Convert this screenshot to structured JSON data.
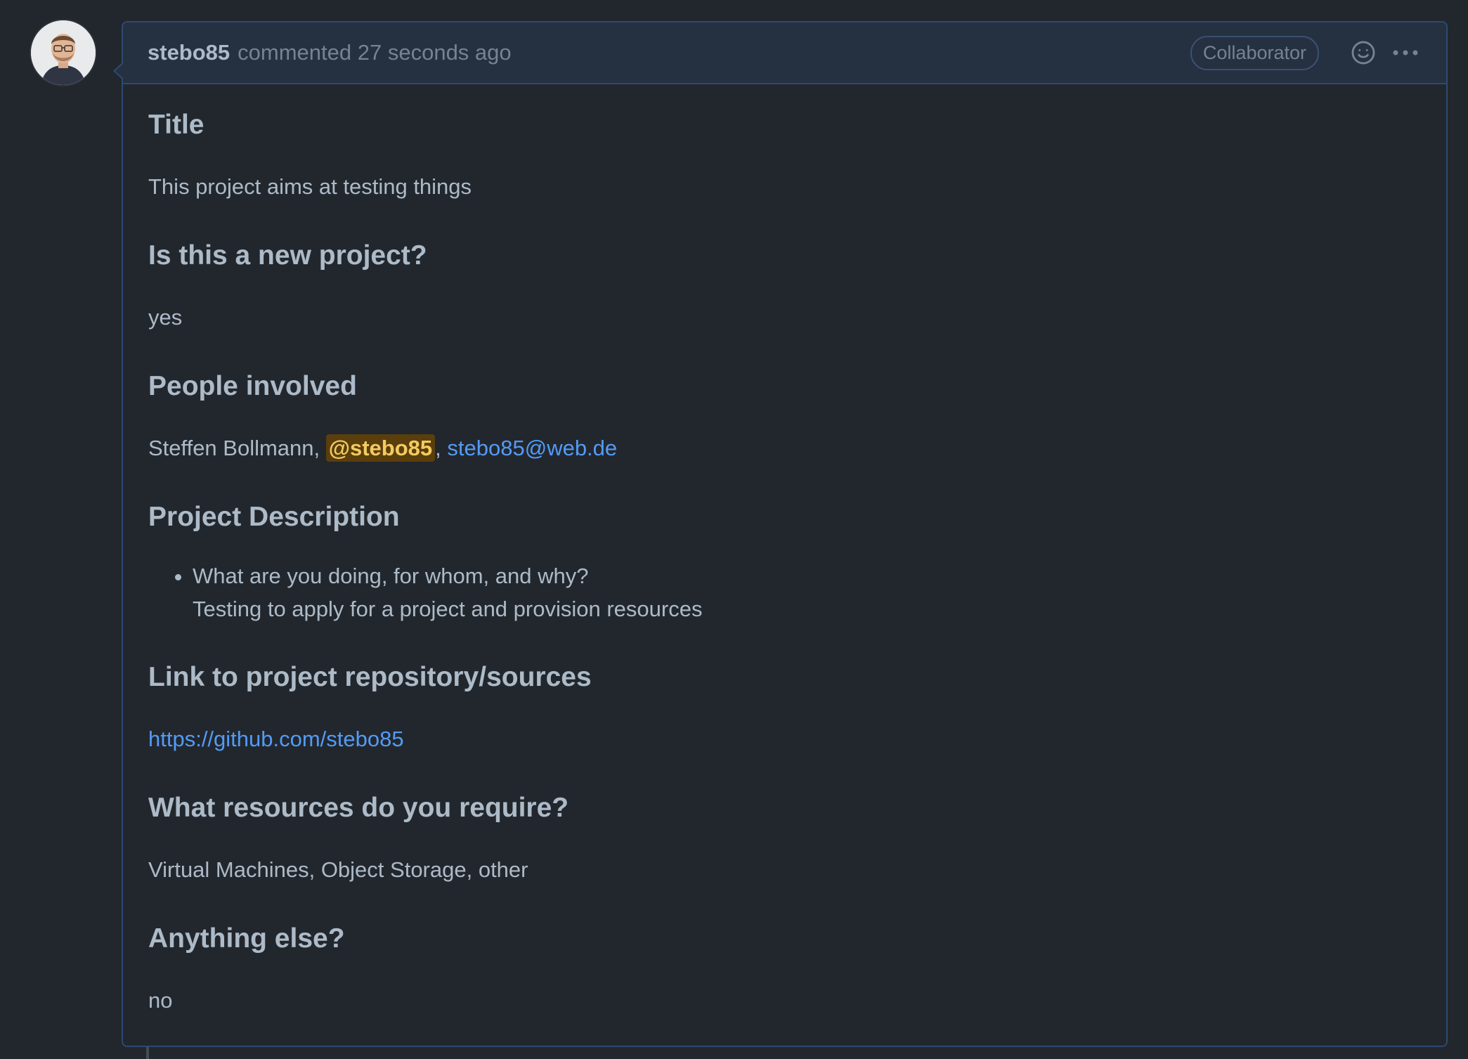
{
  "comment": {
    "author": "stebo85",
    "meta": "commented 27 seconds ago",
    "badge": "Collaborator"
  },
  "sections": [
    {
      "heading": "Title",
      "answer": "This project aims at testing things"
    },
    {
      "heading": "Is this a new project?",
      "answer": "yes"
    },
    {
      "heading": "People involved",
      "name": "Steffen Bollmann,",
      "mention": "@stebo85",
      "separator": ",",
      "email": "stebo85@web.de"
    },
    {
      "heading": "Project Description",
      "bullet_question": "What are you doing, for whom, and why?",
      "bullet_answer": "Testing to apply for a project and provision resources"
    },
    {
      "heading": "Link to project repository/sources",
      "link": "https://github.com/stebo85"
    },
    {
      "heading": "What resources do you require?",
      "answer": "Virtual Machines, Object Storage, other"
    },
    {
      "heading": "Anything else?",
      "answer": "no"
    }
  ],
  "icons": {
    "reaction": "smiley-icon",
    "menu": "kebab-horizontal-icon",
    "avatar": "user-avatar"
  }
}
